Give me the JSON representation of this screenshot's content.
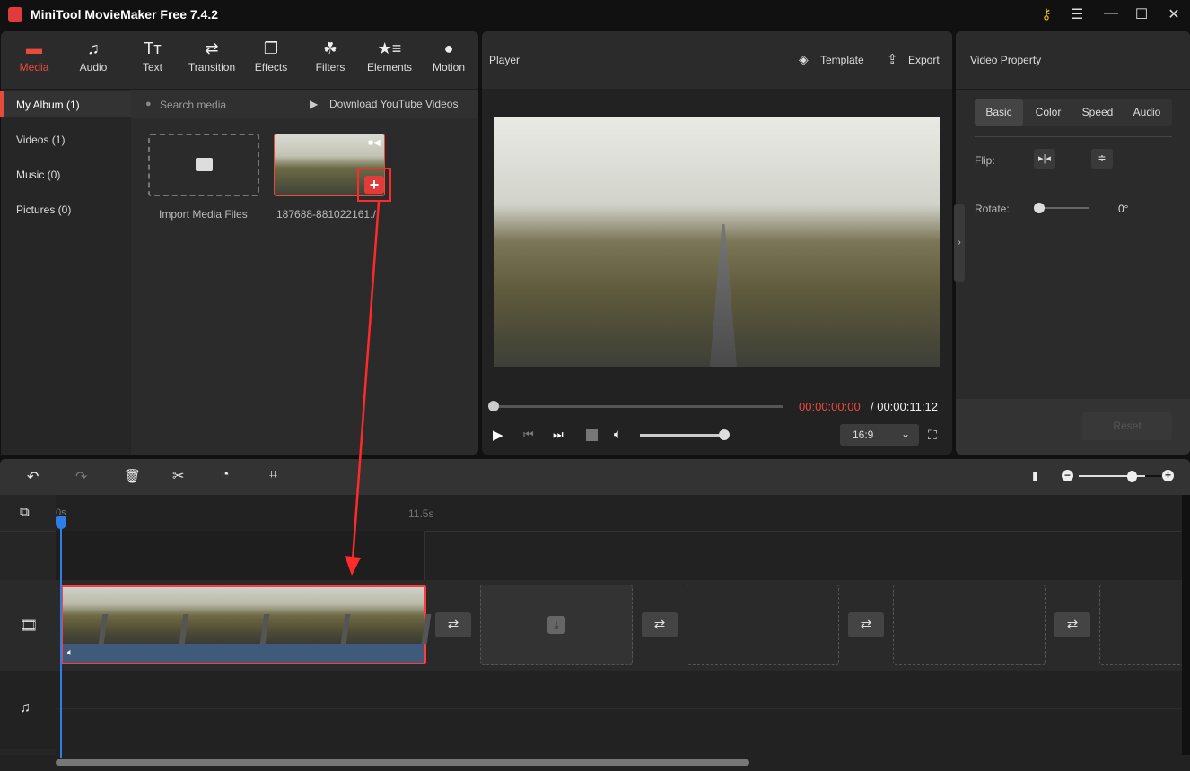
{
  "app": {
    "title": "MiniTool MovieMaker Free 7.4.2"
  },
  "toolbar": [
    {
      "label": "Media",
      "icon": "folder-icon"
    },
    {
      "label": "Audio",
      "icon": "music-icon"
    },
    {
      "label": "Text",
      "icon": "text-icon"
    },
    {
      "label": "Transition",
      "icon": "transition-icon"
    },
    {
      "label": "Effects",
      "icon": "effects-icon"
    },
    {
      "label": "Filters",
      "icon": "filters-icon"
    },
    {
      "label": "Elements",
      "icon": "elements-icon"
    },
    {
      "label": "Motion",
      "icon": "motion-icon"
    }
  ],
  "sidebar": [
    {
      "label": "My Album (1)"
    },
    {
      "label": "Videos (1)"
    },
    {
      "label": "Music (0)"
    },
    {
      "label": "Pictures (0)"
    }
  ],
  "media": {
    "search_placeholder": "Search media",
    "download": "Download YouTube Videos",
    "import": "Import Media Files",
    "clip_name": "187688-881022161./."
  },
  "player": {
    "title": "Player",
    "template": "Template",
    "export": "Export",
    "current": "00:00:00:00",
    "total": "/ 00:00:11:12",
    "aspect": "16:9",
    "volume": 0.95,
    "progress": 0
  },
  "property": {
    "title": "Video Property",
    "tabs": [
      "Basic",
      "Color",
      "Speed",
      "Audio"
    ],
    "flip": "Flip:",
    "rotate": "Rotate:",
    "rotate_value": "0°",
    "reset": "Reset"
  },
  "timeline": {
    "ruler_start": "0s",
    "ruler_mark": "11.5s",
    "zoom": 0.8
  },
  "colors": {
    "accent": "#e84a3c",
    "selection": "#ff2a2a"
  }
}
